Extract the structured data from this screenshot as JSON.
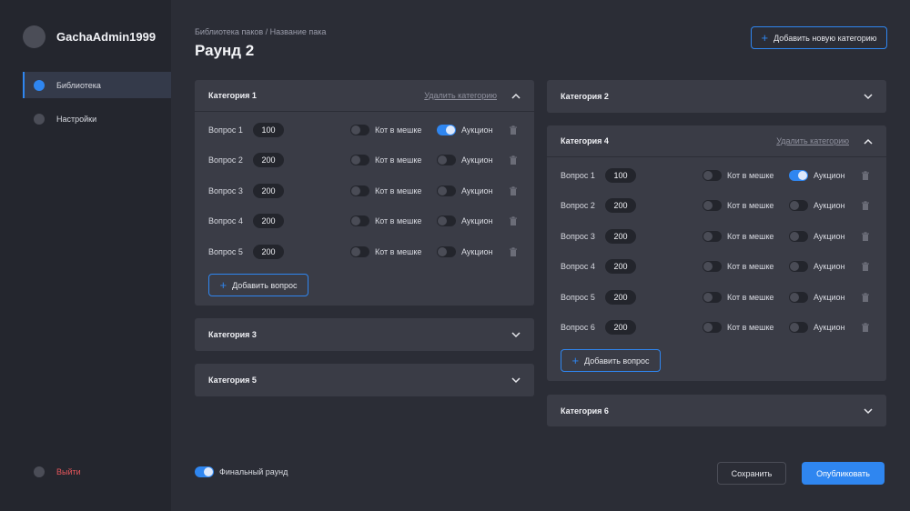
{
  "user": {
    "name": "GachaAdmin1999"
  },
  "nav": {
    "library": "Библиотека",
    "settings": "Настройки",
    "logout": "Выйти"
  },
  "header": {
    "breadcrumb": "Библиотека паков / Название пака",
    "title": "Раунд 2",
    "add_category": "Добавить новую категорию"
  },
  "labels": {
    "cat_in_bag": "Кот в мешке",
    "auction": "Аукцион",
    "delete_category": "Удалить категорию",
    "add_question": "Добавить вопрос"
  },
  "categories": [
    {
      "title": "Категория 1",
      "questions": [
        {
          "label": "Вопрос 1",
          "value": "100",
          "cat_in_bag": false,
          "auction": true
        },
        {
          "label": "Вопрос 2",
          "value": "200",
          "cat_in_bag": false,
          "auction": false
        },
        {
          "label": "Вопрос 3",
          "value": "200",
          "cat_in_bag": false,
          "auction": false
        },
        {
          "label": "Вопрос 4",
          "value": "200",
          "cat_in_bag": false,
          "auction": false
        },
        {
          "label": "Вопрос 5",
          "value": "200",
          "cat_in_bag": false,
          "auction": false
        }
      ]
    },
    {
      "title": "Категория 2"
    },
    {
      "title": "Категория 3"
    },
    {
      "title": "Категория 4",
      "questions": [
        {
          "label": "Вопрос 1",
          "value": "100",
          "cat_in_bag": false,
          "auction": true
        },
        {
          "label": "Вопрос 2",
          "value": "200",
          "cat_in_bag": false,
          "auction": false
        },
        {
          "label": "Вопрос 3",
          "value": "200",
          "cat_in_bag": false,
          "auction": false
        },
        {
          "label": "Вопрос 4",
          "value": "200",
          "cat_in_bag": false,
          "auction": false
        },
        {
          "label": "Вопрос 5",
          "value": "200",
          "cat_in_bag": false,
          "auction": false
        },
        {
          "label": "Вопрос 6",
          "value": "200",
          "cat_in_bag": false,
          "auction": false
        }
      ]
    },
    {
      "title": "Категория 5"
    },
    {
      "title": "Категория 6"
    }
  ],
  "footer": {
    "final_round": "Финальный раунд",
    "final_round_on": true,
    "save": "Сохранить",
    "publish": "Опубликовать"
  },
  "colors": {
    "accent": "#2f86f0",
    "danger": "#e5565b",
    "background": "#2b2d36",
    "card": "#3a3c46"
  }
}
